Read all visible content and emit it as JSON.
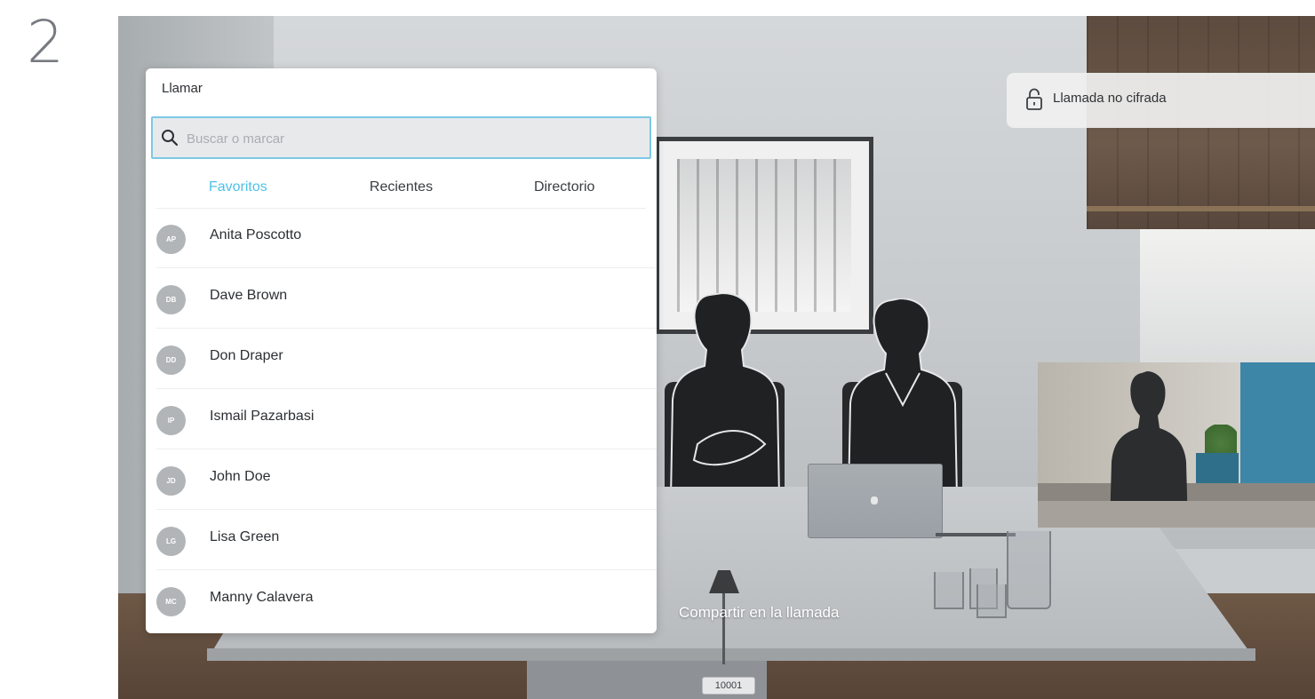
{
  "step_number": "2",
  "call_panel": {
    "title": "Llamar",
    "search": {
      "placeholder": "Buscar o marcar",
      "value": "",
      "icon": "search-icon"
    },
    "tabs": [
      {
        "label": "Favoritos",
        "active": true
      },
      {
        "label": "Recientes",
        "active": false
      },
      {
        "label": "Directorio",
        "active": false
      }
    ],
    "contacts": [
      {
        "initials": "AP",
        "name": "Anita Poscotto"
      },
      {
        "initials": "DB",
        "name": "Dave Brown"
      },
      {
        "initials": "DD",
        "name": "Don Draper"
      },
      {
        "initials": "IP",
        "name": "Ismail Pazarbasi"
      },
      {
        "initials": "JD",
        "name": "John Doe"
      },
      {
        "initials": "LG",
        "name": "Lisa Green"
      },
      {
        "initials": "MC",
        "name": "Manny Calavera"
      }
    ]
  },
  "encryption_notice": {
    "icon": "unlock-icon",
    "text": "Llamada no cifrada"
  },
  "share_label": "Compartir en la llamada",
  "room_number": "10001",
  "colors": {
    "accent": "#4fc0e8",
    "avatar": "#b2b5b8",
    "panel_bg": "#ffffff",
    "text": "#2c2f33"
  }
}
